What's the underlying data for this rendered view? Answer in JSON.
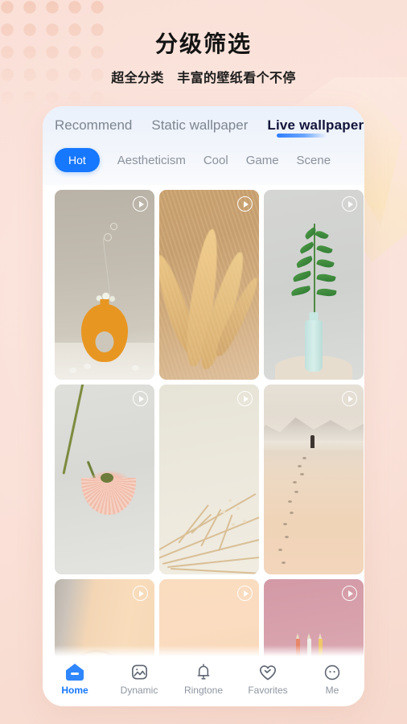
{
  "promo": {
    "title": "分级筛选",
    "subtitle": "超全分类　丰富的壁纸看个不停"
  },
  "colors": {
    "page_background": "#fae0d7",
    "accent_blue": "#1677ff",
    "active_tab_text": "#12143a",
    "inactive_text": "#7d8590",
    "card_surface": "#ffffff"
  },
  "app": {
    "tabs": [
      {
        "label": "Recommend",
        "active": false
      },
      {
        "label": "Static wallpaper",
        "active": false
      },
      {
        "label": "Live wallpaper",
        "active": true
      }
    ],
    "categories": [
      {
        "label": "Hot",
        "active": true
      },
      {
        "label": "Aestheticism",
        "active": false
      },
      {
        "label": "Cool",
        "active": false
      },
      {
        "label": "Game",
        "active": false
      },
      {
        "label": "Scene",
        "active": false
      }
    ],
    "wallpapers": [
      {
        "name": "orange-donut-vase",
        "badge": "play-icon"
      },
      {
        "name": "golden-pampas-grass",
        "badge": "play-icon"
      },
      {
        "name": "green-sprig-glass-bottle",
        "badge": "play-icon"
      },
      {
        "name": "pink-gerbera-daisy",
        "badge": "play-icon"
      },
      {
        "name": "dried-branches",
        "badge": "play-icon"
      },
      {
        "name": "misty-beach-footprints",
        "badge": "play-icon"
      },
      {
        "name": "peach-circle-light",
        "badge": "play-icon"
      },
      {
        "name": "peach-gold-flower",
        "badge": "play-icon"
      },
      {
        "name": "pink-pencils",
        "badge": "play-icon"
      }
    ],
    "bottom_nav": [
      {
        "label": "Home",
        "icon": "home-icon",
        "active": true
      },
      {
        "label": "Dynamic",
        "icon": "image-icon",
        "active": false
      },
      {
        "label": "Ringtone",
        "icon": "bell-icon",
        "active": false
      },
      {
        "label": "Favorites",
        "icon": "heart-icon",
        "active": false
      },
      {
        "label": "Me",
        "icon": "face-icon",
        "active": false
      }
    ]
  }
}
